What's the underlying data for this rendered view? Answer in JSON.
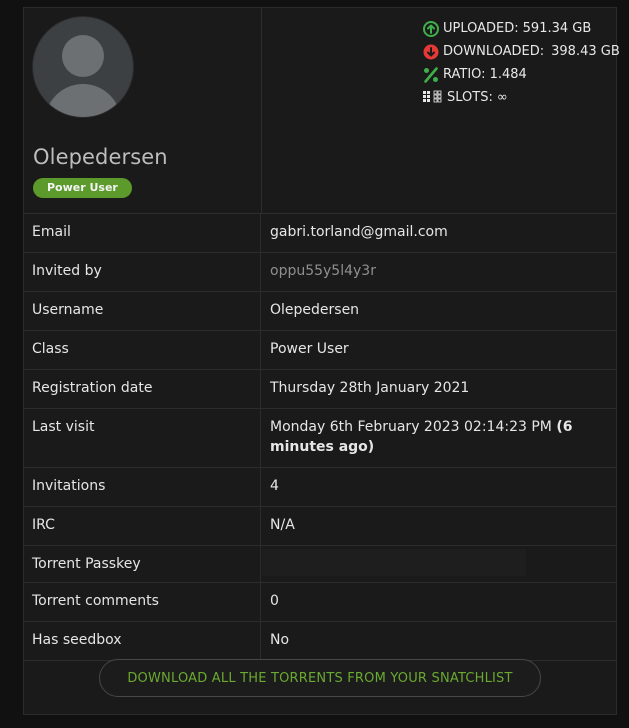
{
  "profile": {
    "username": "Olepedersen",
    "class_badge": "Power User"
  },
  "stats": {
    "uploaded_label": "UPLOADED:",
    "uploaded_value": "591.34 GB",
    "downloaded_label": "DOWNLOADED:",
    "downloaded_value": "398.43 GB",
    "ratio_label": "RATIO:",
    "ratio_value": "1.484",
    "slots_label": "SLOTS:",
    "slots_value": "∞",
    "colors": {
      "uploaded": "#3fb04a",
      "downloaded": "#e53935",
      "ratio": "#3fb04a"
    }
  },
  "info": {
    "email": {
      "label": "Email",
      "value": "gabri.torland@gmail.com"
    },
    "invited_by": {
      "label": "Invited by",
      "value": "oppu55y5l4y3r"
    },
    "username": {
      "label": "Username",
      "value": "Olepedersen"
    },
    "class": {
      "label": "Class",
      "value": "Power User"
    },
    "registration": {
      "label": "Registration date",
      "value": "Thursday 28th January 2021"
    },
    "last_visit": {
      "label": "Last visit",
      "value": "Monday 6th February 2023 02:14:23 PM",
      "ago": "(6 minutes ago)"
    },
    "invitations": {
      "label": "Invitations",
      "value": "4"
    },
    "irc": {
      "label": "IRC",
      "value": "N/A"
    },
    "passkey": {
      "label": "Torrent Passkey",
      "value": ""
    },
    "comments": {
      "label": "Torrent comments",
      "value": "0"
    },
    "seedbox": {
      "label": "Has seedbox",
      "value": "No"
    }
  },
  "actions": {
    "download_snatchlist": "DOWNLOAD ALL THE TORRENTS FROM YOUR SNATCHLIST"
  },
  "icons": {
    "uploaded": "arrow-up-circle-icon",
    "downloaded": "arrow-down-circle-icon",
    "ratio": "percent-icon",
    "slots": "slots-grid-icon",
    "avatar": "default-avatar"
  }
}
